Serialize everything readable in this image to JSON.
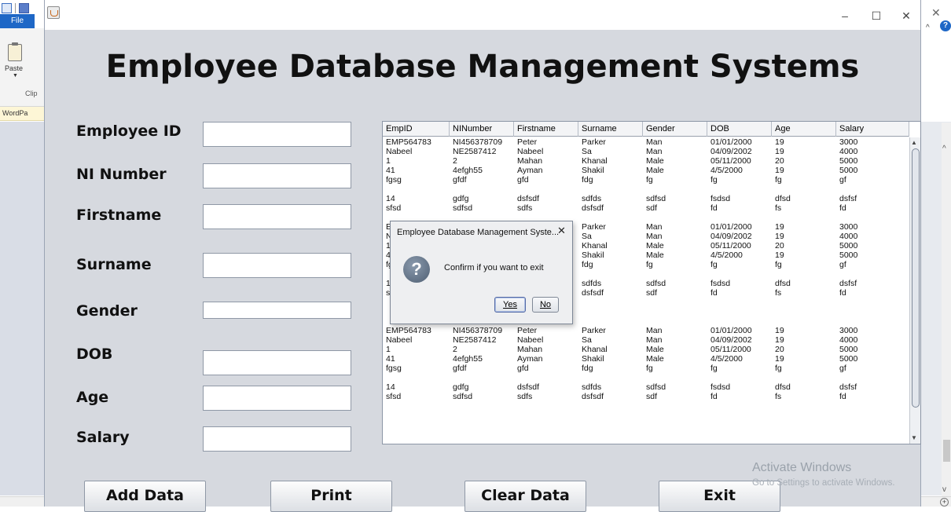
{
  "background_app": {
    "file_tab": "File",
    "paste_label": "Paste",
    "clipboard_group": "Clip",
    "doc_tab": "WordPa"
  },
  "frame": {
    "window_controls": {
      "minimize": "–",
      "maximize": "☐",
      "close": "✕"
    },
    "title": "Employee Database Management Systems"
  },
  "form": {
    "fields": [
      {
        "id": "emp-id",
        "label": "Employee ID",
        "value": ""
      },
      {
        "id": "ni-number",
        "label": "NI Number",
        "value": ""
      },
      {
        "id": "firstname",
        "label": "Firstname",
        "value": ""
      },
      {
        "id": "surname",
        "label": "Surname",
        "value": ""
      },
      {
        "id": "gender",
        "label": "Gender",
        "value": ""
      },
      {
        "id": "dob",
        "label": "DOB",
        "value": ""
      },
      {
        "id": "age",
        "label": "Age",
        "value": ""
      },
      {
        "id": "salary",
        "label": "Salary",
        "value": ""
      }
    ]
  },
  "table": {
    "columns": [
      "EmpID",
      "NINumber",
      "Firstname",
      "Surname",
      "Gender",
      "DOB",
      "Age",
      "Salary"
    ],
    "rows": [
      [
        "EMP564783",
        "NI456378709",
        "Peter",
        "Parker",
        "Man",
        "01/01/2000",
        "19",
        "3000"
      ],
      [
        "Nabeel",
        "NE2587412",
        "Nabeel",
        "Sa",
        "Man",
        "04/09/2002",
        "19",
        "4000"
      ],
      [
        "1",
        "2",
        "Mahan",
        "Khanal",
        "Male",
        "05/11/2000",
        "20",
        "5000"
      ],
      [
        "41",
        "4efgh55",
        "Ayman",
        "Shakil",
        "Male",
        "4/5/2000",
        "19",
        "5000"
      ],
      [
        "fgsg",
        "gfdf",
        "gfd",
        "fdg",
        "fg",
        "fg",
        "fg",
        "gf"
      ],
      [],
      [
        "14",
        "gdfg",
        "dsfsdf",
        "sdfds",
        "sdfsd",
        "fsdsd",
        "dfsd",
        "dsfsf"
      ],
      [
        "sfsd",
        "sdfsd",
        "sdfs",
        "dsfsdf",
        "sdf",
        "fd",
        "fs",
        "fd"
      ],
      [],
      [
        "EMP564783",
        "NI456378709",
        "Peter",
        "Parker",
        "Man",
        "01/01/2000",
        "19",
        "3000"
      ],
      [
        "Nabeel",
        "NE2587412",
        "Nabeel",
        "Sa",
        "Man",
        "04/09/2002",
        "19",
        "4000"
      ],
      [
        "1",
        "2",
        "Mahan",
        "Khanal",
        "Male",
        "05/11/2000",
        "20",
        "5000"
      ],
      [
        "41",
        "4efgh55",
        "Ayman",
        "Shakil",
        "Male",
        "4/5/2000",
        "19",
        "5000"
      ],
      [
        "fgsg",
        "gfdf",
        "gfd",
        "fdg",
        "fg",
        "fg",
        "fg",
        "gf"
      ],
      [],
      [
        "14",
        "gdfg",
        "dsfsdf",
        "sdfds",
        "sdfsd",
        "fsdsd",
        "dfsd",
        "dsfsf"
      ],
      [
        "sfsd",
        "sdfsd",
        "sdfs",
        "dsfsdf",
        "sdf",
        "fd",
        "fs",
        "fd"
      ],
      [],
      [],
      [],
      [
        "EMP564783",
        "NI456378709",
        "Peter",
        "Parker",
        "Man",
        "01/01/2000",
        "19",
        "3000"
      ],
      [
        "Nabeel",
        "NE2587412",
        "Nabeel",
        "Sa",
        "Man",
        "04/09/2002",
        "19",
        "4000"
      ],
      [
        "1",
        "2",
        "Mahan",
        "Khanal",
        "Male",
        "05/11/2000",
        "20",
        "5000"
      ],
      [
        "41",
        "4efgh55",
        "Ayman",
        "Shakil",
        "Male",
        "4/5/2000",
        "19",
        "5000"
      ],
      [
        "fgsg",
        "gfdf",
        "gfd",
        "fdg",
        "fg",
        "fg",
        "fg",
        "gf"
      ],
      [],
      [
        "14",
        "gdfg",
        "dsfsdf",
        "sdfds",
        "sdfsd",
        "fsdsd",
        "dfsd",
        "dsfsf"
      ],
      [
        "sfsd",
        "sdfsd",
        "sdfs",
        "dsfsdf",
        "sdf",
        "fd",
        "fs",
        "fd"
      ]
    ]
  },
  "buttons": {
    "add": "Add Data",
    "print": "Print",
    "clear": "Clear Data",
    "exit": "Exit"
  },
  "watermark": {
    "line1": "Activate Windows",
    "line2": "Go to Settings to activate Windows."
  },
  "dialog": {
    "title": "Employee Database Management Syste...",
    "close": "✕",
    "message": "Confirm if you want to exit",
    "yes": "Yes",
    "no": "No"
  },
  "colors": {
    "frame_bg": "#d6d9df",
    "wordpad_file_tab": "#1e67c6",
    "dialog_default_button_border": "#546aa5"
  }
}
